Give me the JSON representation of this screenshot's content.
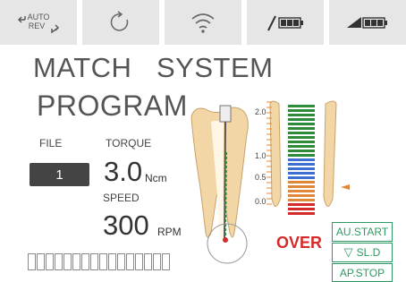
{
  "status_bar": {
    "auto_rev": {
      "label_top": "AUTO",
      "label_bottom": "REV",
      "icon": "auto-reverse-icon"
    },
    "rotate_icon": "rotation-icon",
    "wifi_icon": "wifi-icon",
    "handpiece_battery_icon": "handpiece-battery-icon",
    "motor_battery_icon": "motor-battery-icon"
  },
  "header": {
    "line1_left": "MATCH",
    "line1_right": "SYSTEM",
    "line2": "PROGRAM"
  },
  "file": {
    "label": "FILE",
    "value": "1"
  },
  "torque": {
    "label": "TORQUE",
    "value": "3.0",
    "unit": "Ncm"
  },
  "speed": {
    "label": "SPEED",
    "value": "300",
    "unit": "RPM"
  },
  "progress_cells": 16,
  "apex_meter": {
    "scale": [
      "2.0",
      "1.0",
      "0.5",
      "0.0"
    ],
    "over_label": "OVER",
    "colors": {
      "green": "#2e8b3a",
      "blue": "#3d6fd0",
      "orange": "#e0883a",
      "red": "#d42a2a",
      "tooth": "#f2d6a6"
    }
  },
  "controls": {
    "au_start": "AU.START",
    "sl_d": "SL.D",
    "ap_stop": "AP.STOP",
    "accent": "#2e9a62"
  }
}
